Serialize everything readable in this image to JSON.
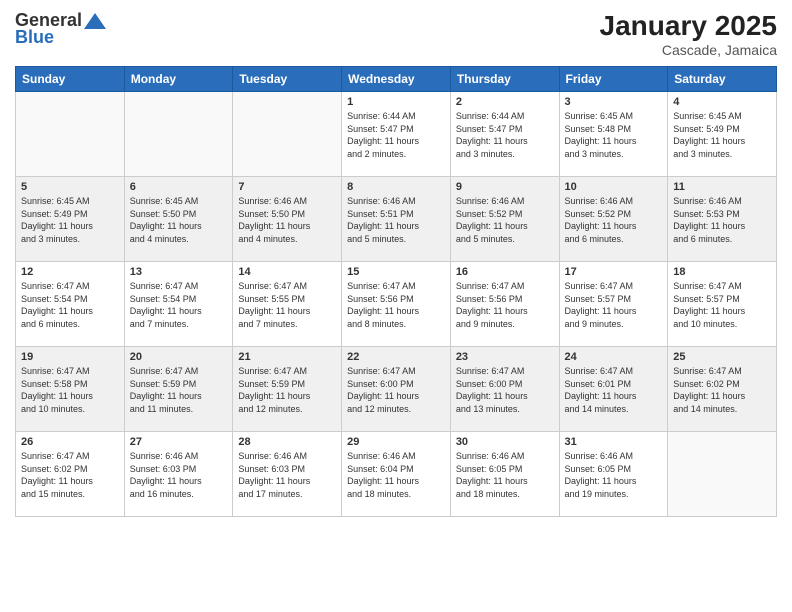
{
  "logo": {
    "general": "General",
    "blue": "Blue"
  },
  "header": {
    "month": "January 2025",
    "location": "Cascade, Jamaica"
  },
  "weekdays": [
    "Sunday",
    "Monday",
    "Tuesday",
    "Wednesday",
    "Thursday",
    "Friday",
    "Saturday"
  ],
  "weeks": [
    [
      {
        "day": "",
        "info": ""
      },
      {
        "day": "",
        "info": ""
      },
      {
        "day": "",
        "info": ""
      },
      {
        "day": "1",
        "info": "Sunrise: 6:44 AM\nSunset: 5:47 PM\nDaylight: 11 hours\nand 2 minutes."
      },
      {
        "day": "2",
        "info": "Sunrise: 6:44 AM\nSunset: 5:47 PM\nDaylight: 11 hours\nand 3 minutes."
      },
      {
        "day": "3",
        "info": "Sunrise: 6:45 AM\nSunset: 5:48 PM\nDaylight: 11 hours\nand 3 minutes."
      },
      {
        "day": "4",
        "info": "Sunrise: 6:45 AM\nSunset: 5:49 PM\nDaylight: 11 hours\nand 3 minutes."
      }
    ],
    [
      {
        "day": "5",
        "info": "Sunrise: 6:45 AM\nSunset: 5:49 PM\nDaylight: 11 hours\nand 3 minutes."
      },
      {
        "day": "6",
        "info": "Sunrise: 6:45 AM\nSunset: 5:50 PM\nDaylight: 11 hours\nand 4 minutes."
      },
      {
        "day": "7",
        "info": "Sunrise: 6:46 AM\nSunset: 5:50 PM\nDaylight: 11 hours\nand 4 minutes."
      },
      {
        "day": "8",
        "info": "Sunrise: 6:46 AM\nSunset: 5:51 PM\nDaylight: 11 hours\nand 5 minutes."
      },
      {
        "day": "9",
        "info": "Sunrise: 6:46 AM\nSunset: 5:52 PM\nDaylight: 11 hours\nand 5 minutes."
      },
      {
        "day": "10",
        "info": "Sunrise: 6:46 AM\nSunset: 5:52 PM\nDaylight: 11 hours\nand 6 minutes."
      },
      {
        "day": "11",
        "info": "Sunrise: 6:46 AM\nSunset: 5:53 PM\nDaylight: 11 hours\nand 6 minutes."
      }
    ],
    [
      {
        "day": "12",
        "info": "Sunrise: 6:47 AM\nSunset: 5:54 PM\nDaylight: 11 hours\nand 6 minutes."
      },
      {
        "day": "13",
        "info": "Sunrise: 6:47 AM\nSunset: 5:54 PM\nDaylight: 11 hours\nand 7 minutes."
      },
      {
        "day": "14",
        "info": "Sunrise: 6:47 AM\nSunset: 5:55 PM\nDaylight: 11 hours\nand 7 minutes."
      },
      {
        "day": "15",
        "info": "Sunrise: 6:47 AM\nSunset: 5:56 PM\nDaylight: 11 hours\nand 8 minutes."
      },
      {
        "day": "16",
        "info": "Sunrise: 6:47 AM\nSunset: 5:56 PM\nDaylight: 11 hours\nand 9 minutes."
      },
      {
        "day": "17",
        "info": "Sunrise: 6:47 AM\nSunset: 5:57 PM\nDaylight: 11 hours\nand 9 minutes."
      },
      {
        "day": "18",
        "info": "Sunrise: 6:47 AM\nSunset: 5:57 PM\nDaylight: 11 hours\nand 10 minutes."
      }
    ],
    [
      {
        "day": "19",
        "info": "Sunrise: 6:47 AM\nSunset: 5:58 PM\nDaylight: 11 hours\nand 10 minutes."
      },
      {
        "day": "20",
        "info": "Sunrise: 6:47 AM\nSunset: 5:59 PM\nDaylight: 11 hours\nand 11 minutes."
      },
      {
        "day": "21",
        "info": "Sunrise: 6:47 AM\nSunset: 5:59 PM\nDaylight: 11 hours\nand 12 minutes."
      },
      {
        "day": "22",
        "info": "Sunrise: 6:47 AM\nSunset: 6:00 PM\nDaylight: 11 hours\nand 12 minutes."
      },
      {
        "day": "23",
        "info": "Sunrise: 6:47 AM\nSunset: 6:00 PM\nDaylight: 11 hours\nand 13 minutes."
      },
      {
        "day": "24",
        "info": "Sunrise: 6:47 AM\nSunset: 6:01 PM\nDaylight: 11 hours\nand 14 minutes."
      },
      {
        "day": "25",
        "info": "Sunrise: 6:47 AM\nSunset: 6:02 PM\nDaylight: 11 hours\nand 14 minutes."
      }
    ],
    [
      {
        "day": "26",
        "info": "Sunrise: 6:47 AM\nSunset: 6:02 PM\nDaylight: 11 hours\nand 15 minutes."
      },
      {
        "day": "27",
        "info": "Sunrise: 6:46 AM\nSunset: 6:03 PM\nDaylight: 11 hours\nand 16 minutes."
      },
      {
        "day": "28",
        "info": "Sunrise: 6:46 AM\nSunset: 6:03 PM\nDaylight: 11 hours\nand 17 minutes."
      },
      {
        "day": "29",
        "info": "Sunrise: 6:46 AM\nSunset: 6:04 PM\nDaylight: 11 hours\nand 18 minutes."
      },
      {
        "day": "30",
        "info": "Sunrise: 6:46 AM\nSunset: 6:05 PM\nDaylight: 11 hours\nand 18 minutes."
      },
      {
        "day": "31",
        "info": "Sunrise: 6:46 AM\nSunset: 6:05 PM\nDaylight: 11 hours\nand 19 minutes."
      },
      {
        "day": "",
        "info": ""
      }
    ]
  ]
}
